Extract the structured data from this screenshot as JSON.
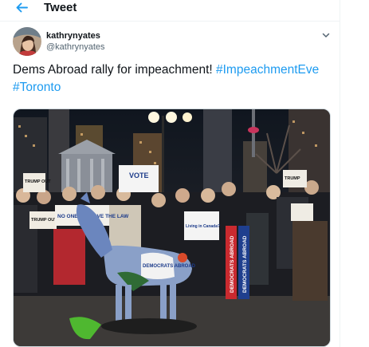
{
  "header": {
    "title": "Tweet"
  },
  "tweet": {
    "display_name": "kathrynyates",
    "handle": "@kathrynyates",
    "text_main": "Dems Abroad rally for impeachment! ",
    "hashtag1": "#ImpeachmentEve",
    "hashtag2": "#Toronto"
  },
  "photo": {
    "sign_trump_out_1": "TRUMP OUT",
    "sign_trump_out_2": "TRUMP OUT",
    "sign_trump_out_3": "TRUMP",
    "sign_no_one": "NO ONE IS ABOVE THE LAW",
    "sign_vote": "VOTE",
    "sign_living_abroad": "Living in Canada?",
    "sign_democrats_abroad_1": "DEMOCRATS ABROAD",
    "sign_democrats_abroad_2": "DEMOCRATS ABROAD",
    "donkey_label": "DEMOCRATS ABROAD"
  },
  "colors": {
    "accent": "#1d9bf0",
    "text": "#0f1419",
    "muted": "#536471"
  },
  "icons": {
    "back": "arrow-left-icon",
    "menu": "chevron-down-icon"
  }
}
